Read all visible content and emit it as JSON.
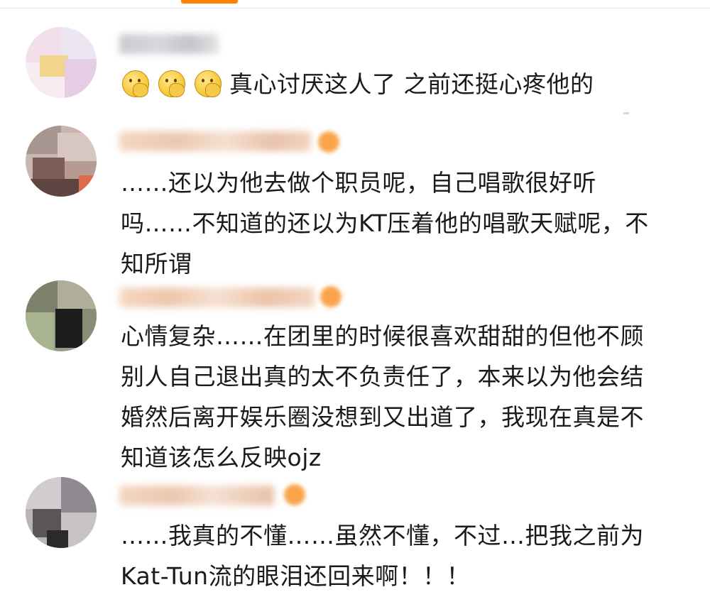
{
  "comments": [
    {
      "text_lines": [
        "真心讨厌这人了 之前还挺心疼他的"
      ],
      "emoji_count": 3
    },
    {
      "text_lines": [
        "……还以为他去做个职员呢，自己唱歌很好听",
        "吗……不知道的还以为KT压着他的唱歌天赋呢，不",
        "知所谓"
      ]
    },
    {
      "text_lines": [
        "心情复杂……在团里的时候很喜欢甜甜的但他不顾",
        "别人自己退出真的太不负责任了，本来以为他会结",
        "婚然后离开娱乐圈没想到又出道了，我现在真是不",
        "知道该怎么反映ojz"
      ]
    },
    {
      "text_lines": [
        "……我真的不懂……虽然不懂，不过…把我之前为",
        "Kat-Tun流的眼泪还回来啊！！！"
      ]
    }
  ],
  "icons": {
    "emoji": "thinking-face-icon"
  },
  "colors": {
    "accent": "#ff8200",
    "text": "#1a1a1a",
    "vip_badge": "#f9a44c"
  }
}
